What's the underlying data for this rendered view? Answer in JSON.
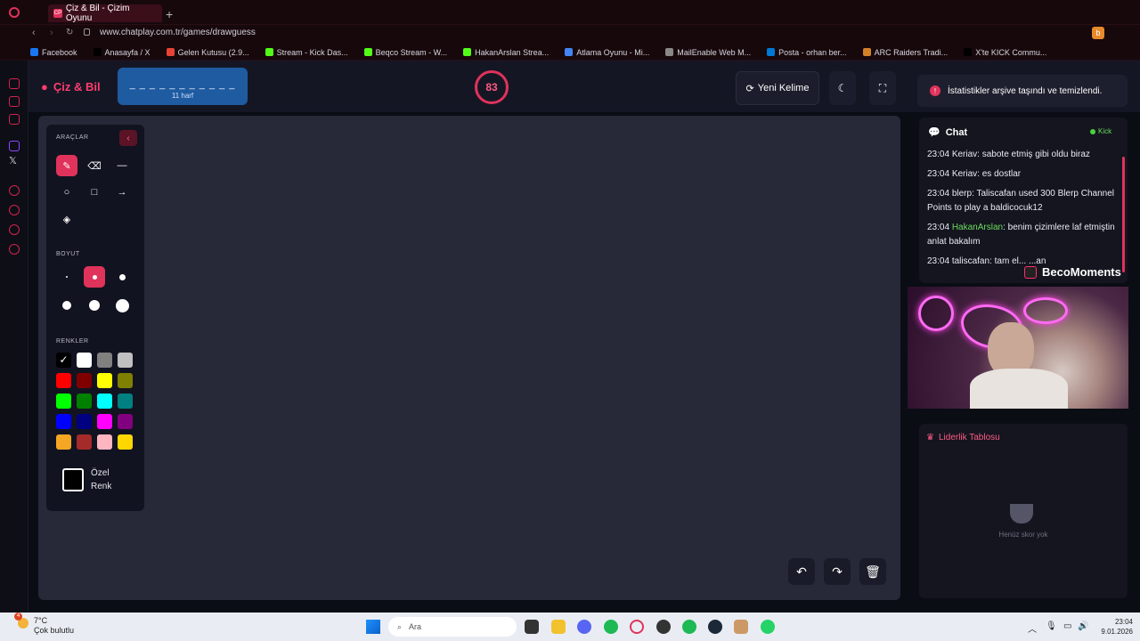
{
  "browser": {
    "tab_title": "Çiz & Bil - Çizim Oyunu",
    "url": "www.chatplay.com.tr/games/drawguess",
    "bookmarks": [
      "Facebook",
      "Anasayfa / X",
      "Gelen Kutusu (2.9...",
      "Stream - Kick Das...",
      "Beqco Stream - W...",
      "HakanArslan Strea...",
      "Atlama Oyunu - Mi...",
      "MailEnable Web M...",
      "Posta - orhan ber...",
      "ARC Raiders Tradi...",
      "X'te KICK Commu..."
    ]
  },
  "header": {
    "logo": "Çiz & Bil",
    "word_dashes": "_ _ _ _ _ _ _ _ _ _ _",
    "letter_count": "11 harf",
    "timer": "83",
    "new_word_label": "Yeni Kelime",
    "toast": "İstatistikler arşive taşındı ve temizlendi."
  },
  "tools": {
    "tools_label": "ARAÇLAR",
    "size_label": "BOYUT",
    "colors_label": "RENKLER",
    "custom_color_label_1": "Özel",
    "custom_color_label_2": "Renk",
    "palette": [
      "#000000",
      "#ffffff",
      "#808080",
      "#c0c0c0",
      "#ff0000",
      "#800000",
      "#ffff00",
      "#808000",
      "#00ff00",
      "#008000",
      "#00ffff",
      "#008080",
      "#0000ff",
      "#000080",
      "#ff00ff",
      "#800080",
      "#f5a623",
      "#a52a2a",
      "#ffb6c1",
      "#ffd700"
    ],
    "accent": "#e0335b"
  },
  "chat": {
    "title": "Chat",
    "platform": "Kick",
    "messages": [
      {
        "time": "23:04",
        "user": "Keriav",
        "text": "sabote etmiş gibi oldu biraz"
      },
      {
        "time": "23:04",
        "user": "Keriav",
        "text": "es dostlar"
      },
      {
        "time": "23:04",
        "user": "blerp",
        "text": "Taliscafan used 300 Blerp Channel Points to play a baldicocuk12"
      },
      {
        "time": "23:04",
        "user": "HakanArslan",
        "text": "benim çizimlere laf etmiştin anlat bakalım"
      },
      {
        "time": "23:04",
        "user": "taliscafan",
        "text": "tam el... ...an"
      }
    ]
  },
  "stream_overlay": {
    "name": "BecoMoments"
  },
  "leaderboard": {
    "title": "Liderlik Tablosu",
    "empty": "Henüz skor yok"
  },
  "taskbar": {
    "temp": "7°C",
    "weather": "Çok bulutlu",
    "weather_badge": "4",
    "search": "Ara",
    "time": "23:04",
    "date": "9.01.2026"
  }
}
